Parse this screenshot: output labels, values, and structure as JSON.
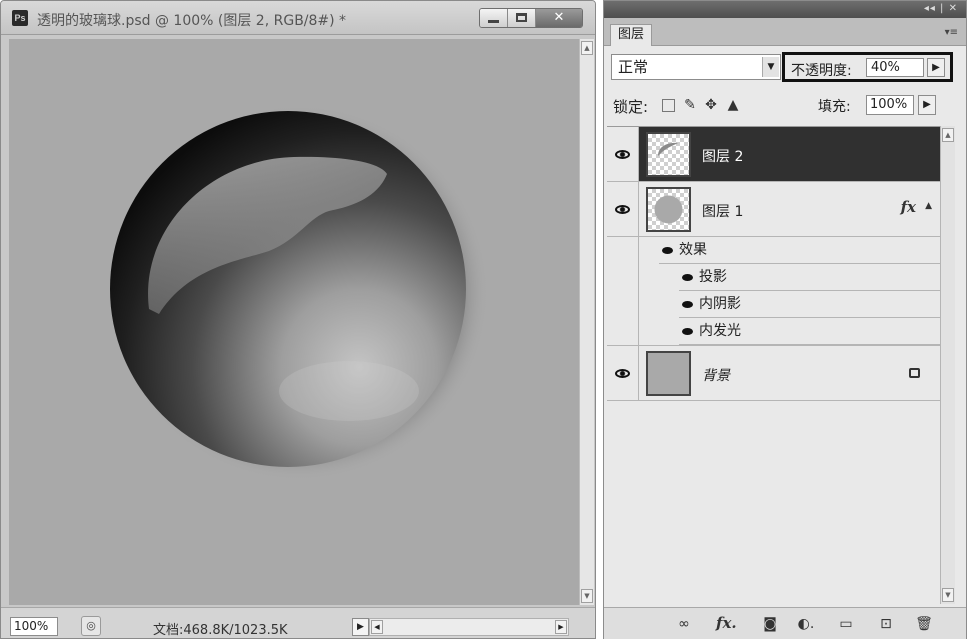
{
  "document": {
    "app_badge": "Ps",
    "title": "透明的玻璃球.psd @ 100% (图层 2, RGB/8#) *",
    "close_glyph": "✕",
    "zoom": "100%",
    "doc_info": "文档:468.8K/1023.5K"
  },
  "layers_panel": {
    "tab_label": "图层",
    "blend_mode": "正常",
    "opacity_label": "不透明度:",
    "opacity_value": "40%",
    "lock_label": "锁定:",
    "fill_label": "填充:",
    "fill_value": "100%",
    "layers": [
      {
        "name": "图层 2",
        "selected": true
      },
      {
        "name": "图层 1",
        "has_fx": true,
        "fx_label": "fx"
      },
      {
        "name": "背景",
        "locked": true
      }
    ],
    "effects_header": "效果",
    "effects": [
      "投影",
      "内阴影",
      "内发光"
    ],
    "bottom_icons": [
      "link-icon",
      "fx-icon",
      "mask-icon",
      "adjustment-icon",
      "group-icon",
      "new-layer-icon",
      "delete-icon"
    ]
  },
  "colors": {
    "canvas_bg": "#a9a9a9",
    "selected_layer": "#303030",
    "panel_bg": "#e9e9e9"
  }
}
